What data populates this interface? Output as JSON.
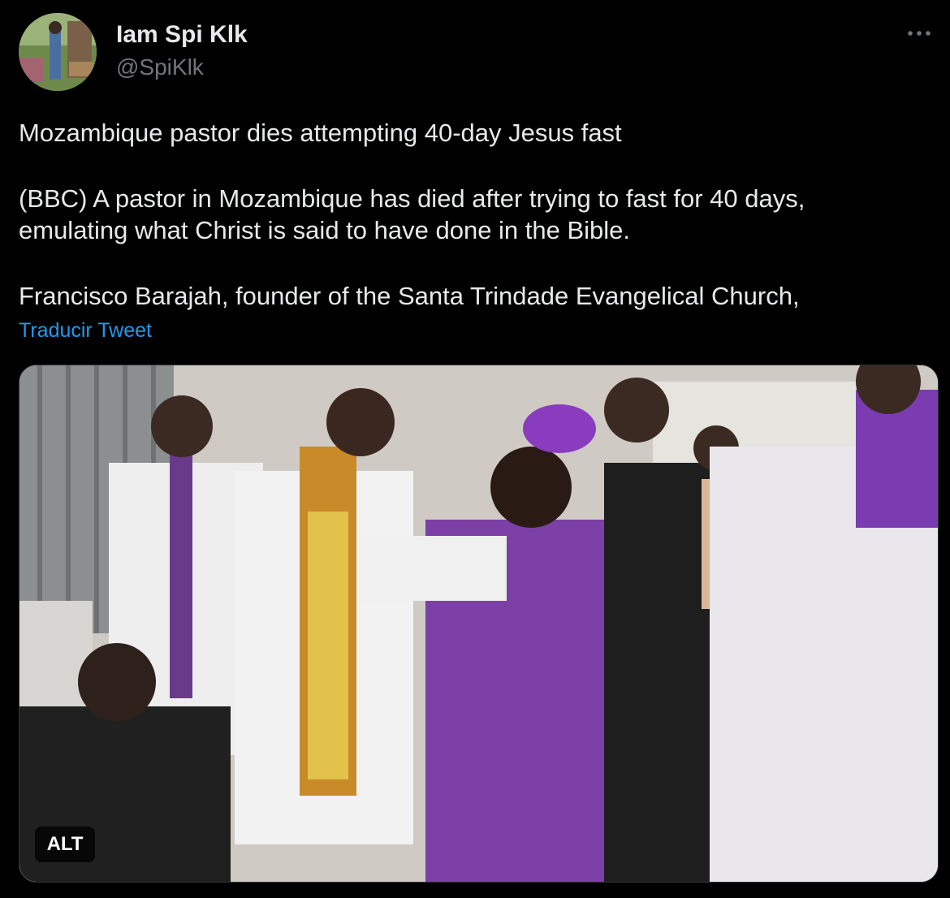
{
  "author": {
    "display_name": "Iam Spi Klk",
    "handle": "@SpiKlk",
    "avatar_icon": "profile-photo"
  },
  "actions": {
    "more_icon": "ellipsis-icon"
  },
  "tweet": {
    "lines": [
      "Mozambique pastor dies attempting 40-day Jesus fast",
      "(BBC) A pastor in Mozambique has died after trying to fast for 40 days,",
      "emulating what Christ is said to have done in the Bible.",
      "Francisco Barajah, founder of the Santa Trindade Evangelical Church,"
    ],
    "translate_label": "Traducir Tweet"
  },
  "media": {
    "alt_label": "ALT"
  },
  "colors": {
    "background": "#000000",
    "text_primary": "#e7e9ea",
    "text_secondary": "#71767b",
    "link": "#1d9bf0",
    "border": "#2f3336"
  }
}
